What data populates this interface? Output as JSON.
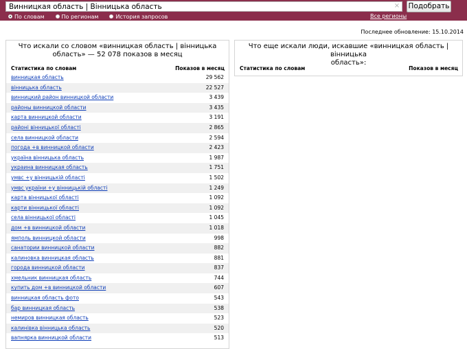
{
  "search": {
    "value": "Винницкая область | Вінницька область",
    "button_label": "Подобрать",
    "clear_icon": "×"
  },
  "modes": [
    {
      "label": "По словам",
      "selected": true
    },
    {
      "label": "По регионам",
      "selected": false
    },
    {
      "label": "История запросов",
      "selected": false
    }
  ],
  "all_regions_label": "Все регионы",
  "updated_text": "Последнее обновление: 15.10.2014",
  "left_panel": {
    "title_line1": "Что искали со словом «винницкая область | вінницька",
    "title_line2": "область» — 52 078 показов в месяц",
    "col_stats": "Статистика по словам",
    "col_views": "Показов в месяц",
    "rows": [
      {
        "kw": "винницкая область",
        "count": "29 562"
      },
      {
        "kw": "вінницька область",
        "count": "22 527"
      },
      {
        "kw": "винницкий район винницкой области",
        "count": "3 439"
      },
      {
        "kw": "районы винницкой области",
        "count": "3 435"
      },
      {
        "kw": "карта винницкой области",
        "count": "3 191"
      },
      {
        "kw": "районі вінницької області",
        "count": "2 865"
      },
      {
        "kw": "села винницкой области",
        "count": "2 594"
      },
      {
        "kw": "погода +в винницкой области",
        "count": "2 423"
      },
      {
        "kw": "україна вінницька область",
        "count": "1 987"
      },
      {
        "kw": "украина винницкая область",
        "count": "1 751"
      },
      {
        "kw": "умвс +у вінницькій області",
        "count": "1 502"
      },
      {
        "kw": "умвс україни +у вінницькій області",
        "count": "1 249"
      },
      {
        "kw": "карта вінницької області",
        "count": "1 092"
      },
      {
        "kw": "карти вінницької області",
        "count": "1 092"
      },
      {
        "kw": "села вінницької області",
        "count": "1 045"
      },
      {
        "kw": "дом +в винницкой области",
        "count": "1 018"
      },
      {
        "kw": "ямполь винницкой области",
        "count": "998"
      },
      {
        "kw": "санатории винницкой области",
        "count": "882"
      },
      {
        "kw": "калиновка винницкая область",
        "count": "881"
      },
      {
        "kw": "города винницкой области",
        "count": "837"
      },
      {
        "kw": "хмельник винницкая область",
        "count": "744"
      },
      {
        "kw": "купить дом +в винницкой области",
        "count": "607"
      },
      {
        "kw": "винницкая область фото",
        "count": "543"
      },
      {
        "kw": "бар винницкая область",
        "count": "538"
      },
      {
        "kw": "немиров винницкая область",
        "count": "523"
      },
      {
        "kw": "калинівка вінницька область",
        "count": "520"
      },
      {
        "kw": "вапнярка винницкой области",
        "count": "513"
      }
    ]
  },
  "right_panel": {
    "title_line1": "Что еще искали люди, искавшие «винницкая область | вінницька",
    "title_line2": "область»:",
    "col_stats": "Статистика по словам",
    "col_views": "Показов в месяц"
  }
}
